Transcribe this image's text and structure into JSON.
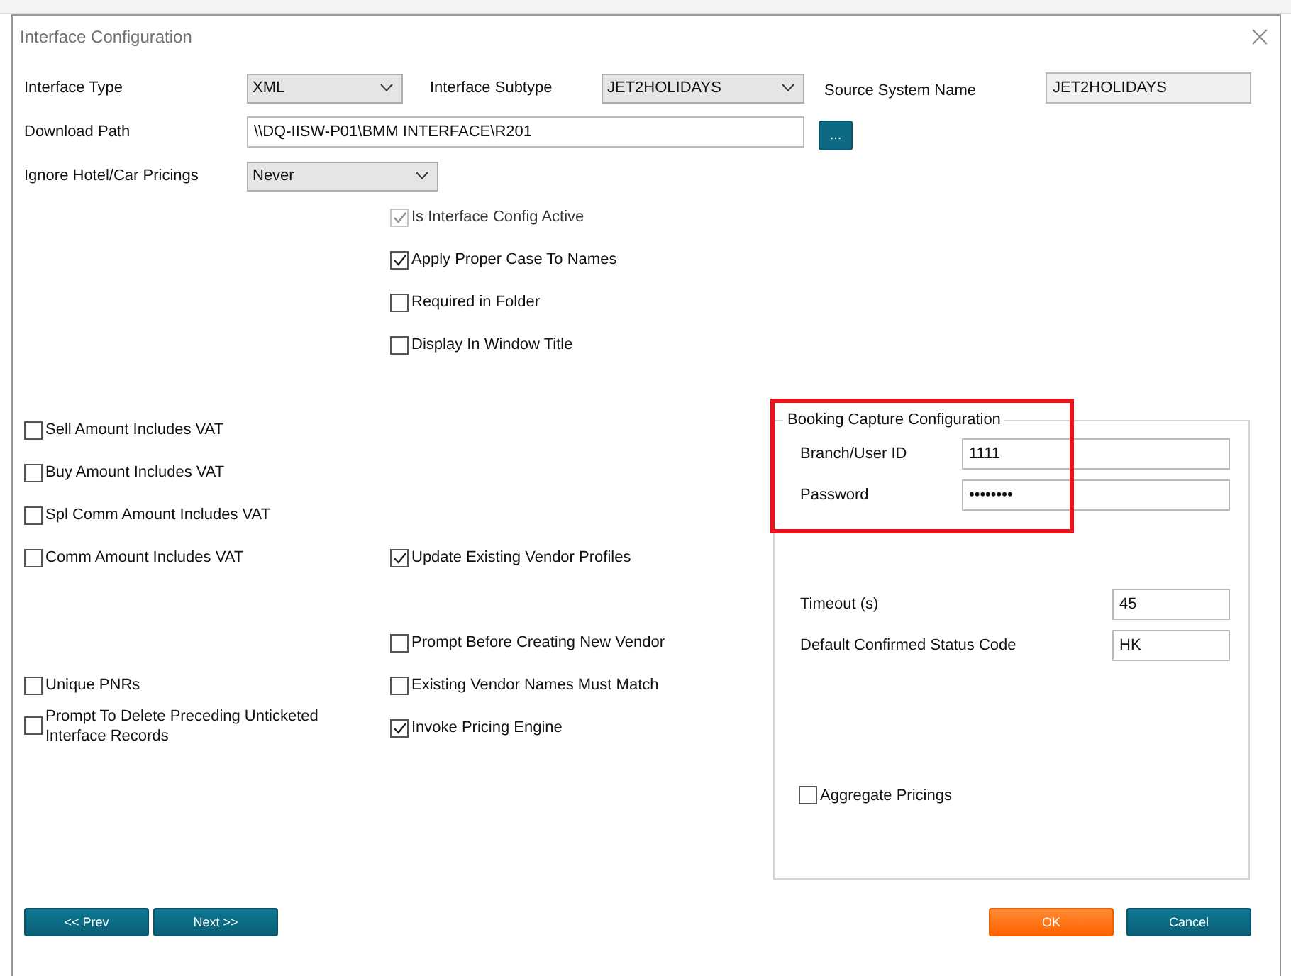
{
  "window": {
    "title": "Interface Configuration"
  },
  "top_fields": {
    "interface_type": {
      "label": "Interface Type",
      "value": "XML"
    },
    "interface_subtype": {
      "label": "Interface Subtype",
      "value": "JET2HOLIDAYS"
    },
    "source_system_name": {
      "label": "Source System Name",
      "value": "JET2HOLIDAYS"
    },
    "download_path": {
      "label": "Download Path",
      "value": "\\\\DQ-IISW-P01\\BMM INTERFACE\\R201",
      "browse_button": "..."
    },
    "ignore_pricings": {
      "label": "Ignore Hotel/Car Pricings",
      "value": "Never"
    }
  },
  "options_left": [
    {
      "label": "Sell Amount Includes VAT",
      "checked": false
    },
    {
      "label": "Buy Amount Includes VAT",
      "checked": false
    },
    {
      "label": "Spl Comm Amount Includes VAT",
      "checked": false
    },
    {
      "label": "Comm Amount Includes VAT",
      "checked": false
    },
    {
      "label": "Unique PNRs",
      "checked": false
    },
    {
      "label": "Prompt To Delete Preceding Unticketed Interface Records",
      "checked": false
    }
  ],
  "options_middle": [
    {
      "label": "Is Interface Config Active",
      "checked": true,
      "disabled": true
    },
    {
      "label": "Apply Proper Case To Names",
      "checked": true,
      "disabled": false
    },
    {
      "label": "Required in Folder",
      "checked": false,
      "disabled": false
    },
    {
      "label": "Display In Window Title",
      "checked": false,
      "disabled": false
    },
    {
      "label": "Update Existing Vendor Profiles",
      "checked": true,
      "disabled": false
    },
    {
      "label": "Prompt Before Creating New Vendor",
      "checked": false,
      "disabled": false
    },
    {
      "label": "Existing Vendor Names Must Match",
      "checked": false,
      "disabled": false
    },
    {
      "label": "Invoke Pricing Engine",
      "checked": true,
      "disabled": false
    }
  ],
  "booking_capture": {
    "title": "Booking Capture Configuration",
    "credentials": [
      {
        "label": "Branch/User ID",
        "value": "1111"
      },
      {
        "label": "Password",
        "value": "••••••••"
      }
    ],
    "settings": [
      {
        "label": "Timeout (s)",
        "value": "45"
      },
      {
        "label": "Default Confirmed Status Code",
        "value": "HK"
      }
    ],
    "aggregate_pricings": {
      "label": "Aggregate Pricings",
      "checked": false
    }
  },
  "buttons": {
    "prev": "<< Prev",
    "next": "Next >>",
    "ok": "OK",
    "cancel": "Cancel"
  }
}
